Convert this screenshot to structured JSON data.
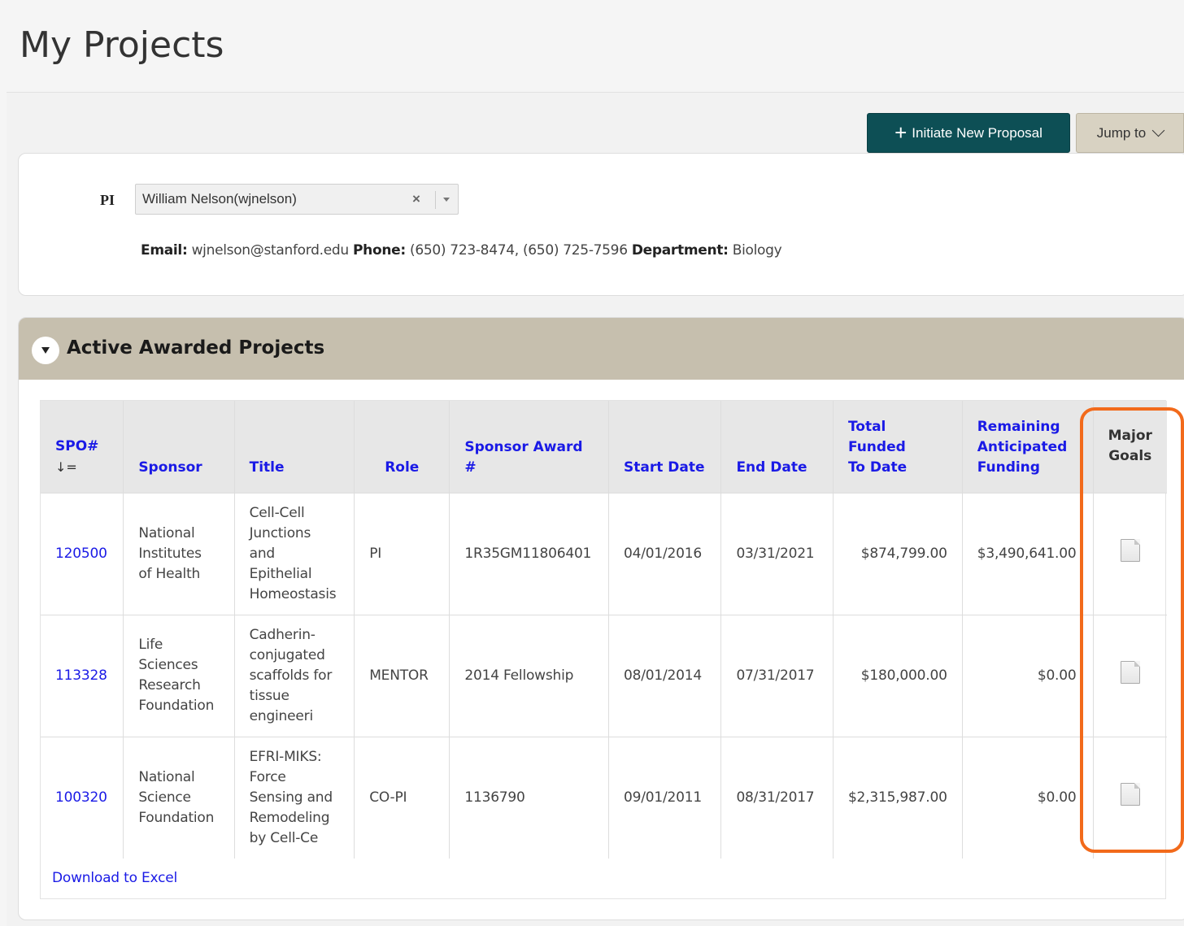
{
  "page": {
    "title": "My Projects"
  },
  "toolbar": {
    "initiate_label": "Initiate New Proposal",
    "jump_label": "Jump to"
  },
  "pi": {
    "label": "PI",
    "selected": "William Nelson(wjnelson)",
    "clear_symbol": "×",
    "email_label": "Email:",
    "email": "wjnelson@stanford.edu",
    "phone_label": "Phone:",
    "phone": "(650) 723-8474, (650) 725-7596",
    "department_label": "Department:",
    "department": "Biology"
  },
  "awards": {
    "title": "Active Awarded Projects",
    "columns": {
      "spo": "SPO#",
      "sort_indicator": "↓=",
      "sponsor": "Sponsor",
      "title": "Title",
      "role": "Role",
      "award": "Sponsor Award #",
      "start": "Start Date",
      "end": "End Date",
      "funded_1": "Total",
      "funded_2": "Funded",
      "funded_3": "To Date",
      "remaining_1": "Remaining",
      "remaining_2": "Anticipated",
      "remaining_3": "Funding",
      "goals_1": "Major",
      "goals_2": "Goals"
    },
    "rows": [
      {
        "spo": "120500",
        "sponsor": [
          "National",
          "Institutes",
          "of Health"
        ],
        "title": [
          "Cell-Cell",
          "Junctions",
          "and",
          "Epithelial",
          "Homeostasis"
        ],
        "role": "PI",
        "award": "1R35GM11806401",
        "start": "04/01/2016",
        "end": "03/31/2021",
        "funded": "$874,799.00",
        "remaining": "$3,490,641.00"
      },
      {
        "spo": "113328",
        "sponsor": [
          "Life",
          "Sciences",
          "Research",
          "Foundation"
        ],
        "title": [
          "Cadherin-",
          "conjugated",
          "scaffolds for",
          "tissue",
          "engineeri"
        ],
        "role": "MENTOR",
        "award": "2014 Fellowship",
        "start": "08/01/2014",
        "end": "07/31/2017",
        "funded": "$180,000.00",
        "remaining": "$0.00"
      },
      {
        "spo": "100320",
        "sponsor": [
          "National",
          "Science",
          "Foundation"
        ],
        "title": [
          "EFRI-MIKS:",
          "Force",
          "Sensing and",
          "Remodeling",
          "by Cell-Ce"
        ],
        "role": "CO-PI",
        "award": "1136790",
        "start": "09/01/2011",
        "end": "08/31/2017",
        "funded": "$2,315,987.00",
        "remaining": "$0.00"
      }
    ],
    "download_label": "Download to Excel"
  },
  "icons": {
    "plus": "plus-icon",
    "chevron": "chevron-down-icon",
    "toggle": "collapse-triangle-icon",
    "document": "document-icon"
  },
  "colors": {
    "primary_button": "#0d4f55",
    "jump_button": "#d8d2c2",
    "panel_header": "#c6bfae",
    "link": "#1a1ae6",
    "highlight": "#f26a1b"
  }
}
